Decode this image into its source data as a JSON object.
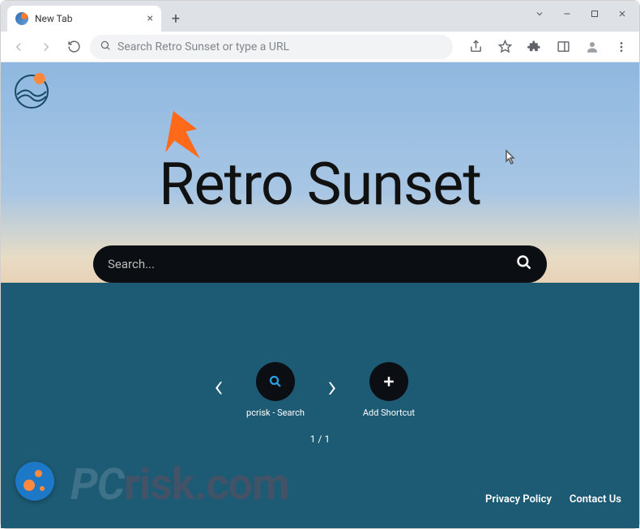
{
  "window": {
    "tab_title": "New Tab",
    "controls": {
      "minimize": "min",
      "maximize": "max",
      "close": "close"
    }
  },
  "toolbar": {
    "omnibox_placeholder": "Search Retro Sunset or type a URL"
  },
  "page": {
    "brand_title": "Retro Sunset",
    "search_placeholder": "Search...",
    "shortcuts": [
      {
        "label": "pcrisk - Search",
        "icon": "search"
      },
      {
        "label": "Add Shortcut",
        "icon": "plus"
      }
    ],
    "pager": "1 / 1",
    "footer": {
      "privacy": "Privacy Policy",
      "contact": "Contact Us"
    }
  },
  "watermark": {
    "prefix": "PC",
    "suffix": "risk.com"
  },
  "colors": {
    "sea": "#1d5a74",
    "accent_orange": "#ff6a1a",
    "fab_blue": "#1e78c8"
  }
}
